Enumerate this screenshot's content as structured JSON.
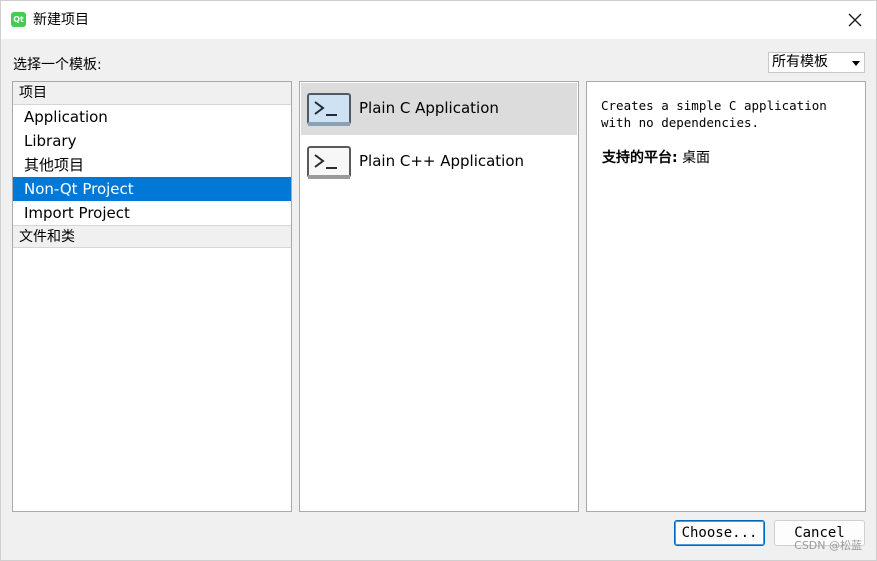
{
  "window": {
    "title": "新建项目",
    "app_icon_text": "Qt"
  },
  "prompt": "选择一个模板:",
  "filter": {
    "selected": "所有模板"
  },
  "categories": {
    "group1_header": "项目",
    "items": [
      "Application",
      "Library",
      "其他项目",
      "Non-Qt Project",
      "Import Project"
    ],
    "selected_index": 3,
    "group2_header": "文件和类"
  },
  "templates": [
    {
      "label": "Plain C Application",
      "icon": "terminal-icon",
      "selected": true
    },
    {
      "label": "Plain C++ Application",
      "icon": "terminal-icon",
      "selected": false
    }
  ],
  "description": {
    "text": "Creates a simple C application\nwith no dependencies.",
    "platforms_label": "支持的平台:",
    "platforms_value": "桌面"
  },
  "buttons": {
    "choose": "Choose...",
    "cancel": "Cancel"
  },
  "watermark": "CSDN @松蓝",
  "colors": {
    "selection_blue": "#0078d7",
    "template_selected_bg": "#dcdcdc",
    "qt_green": "#41cd52"
  }
}
